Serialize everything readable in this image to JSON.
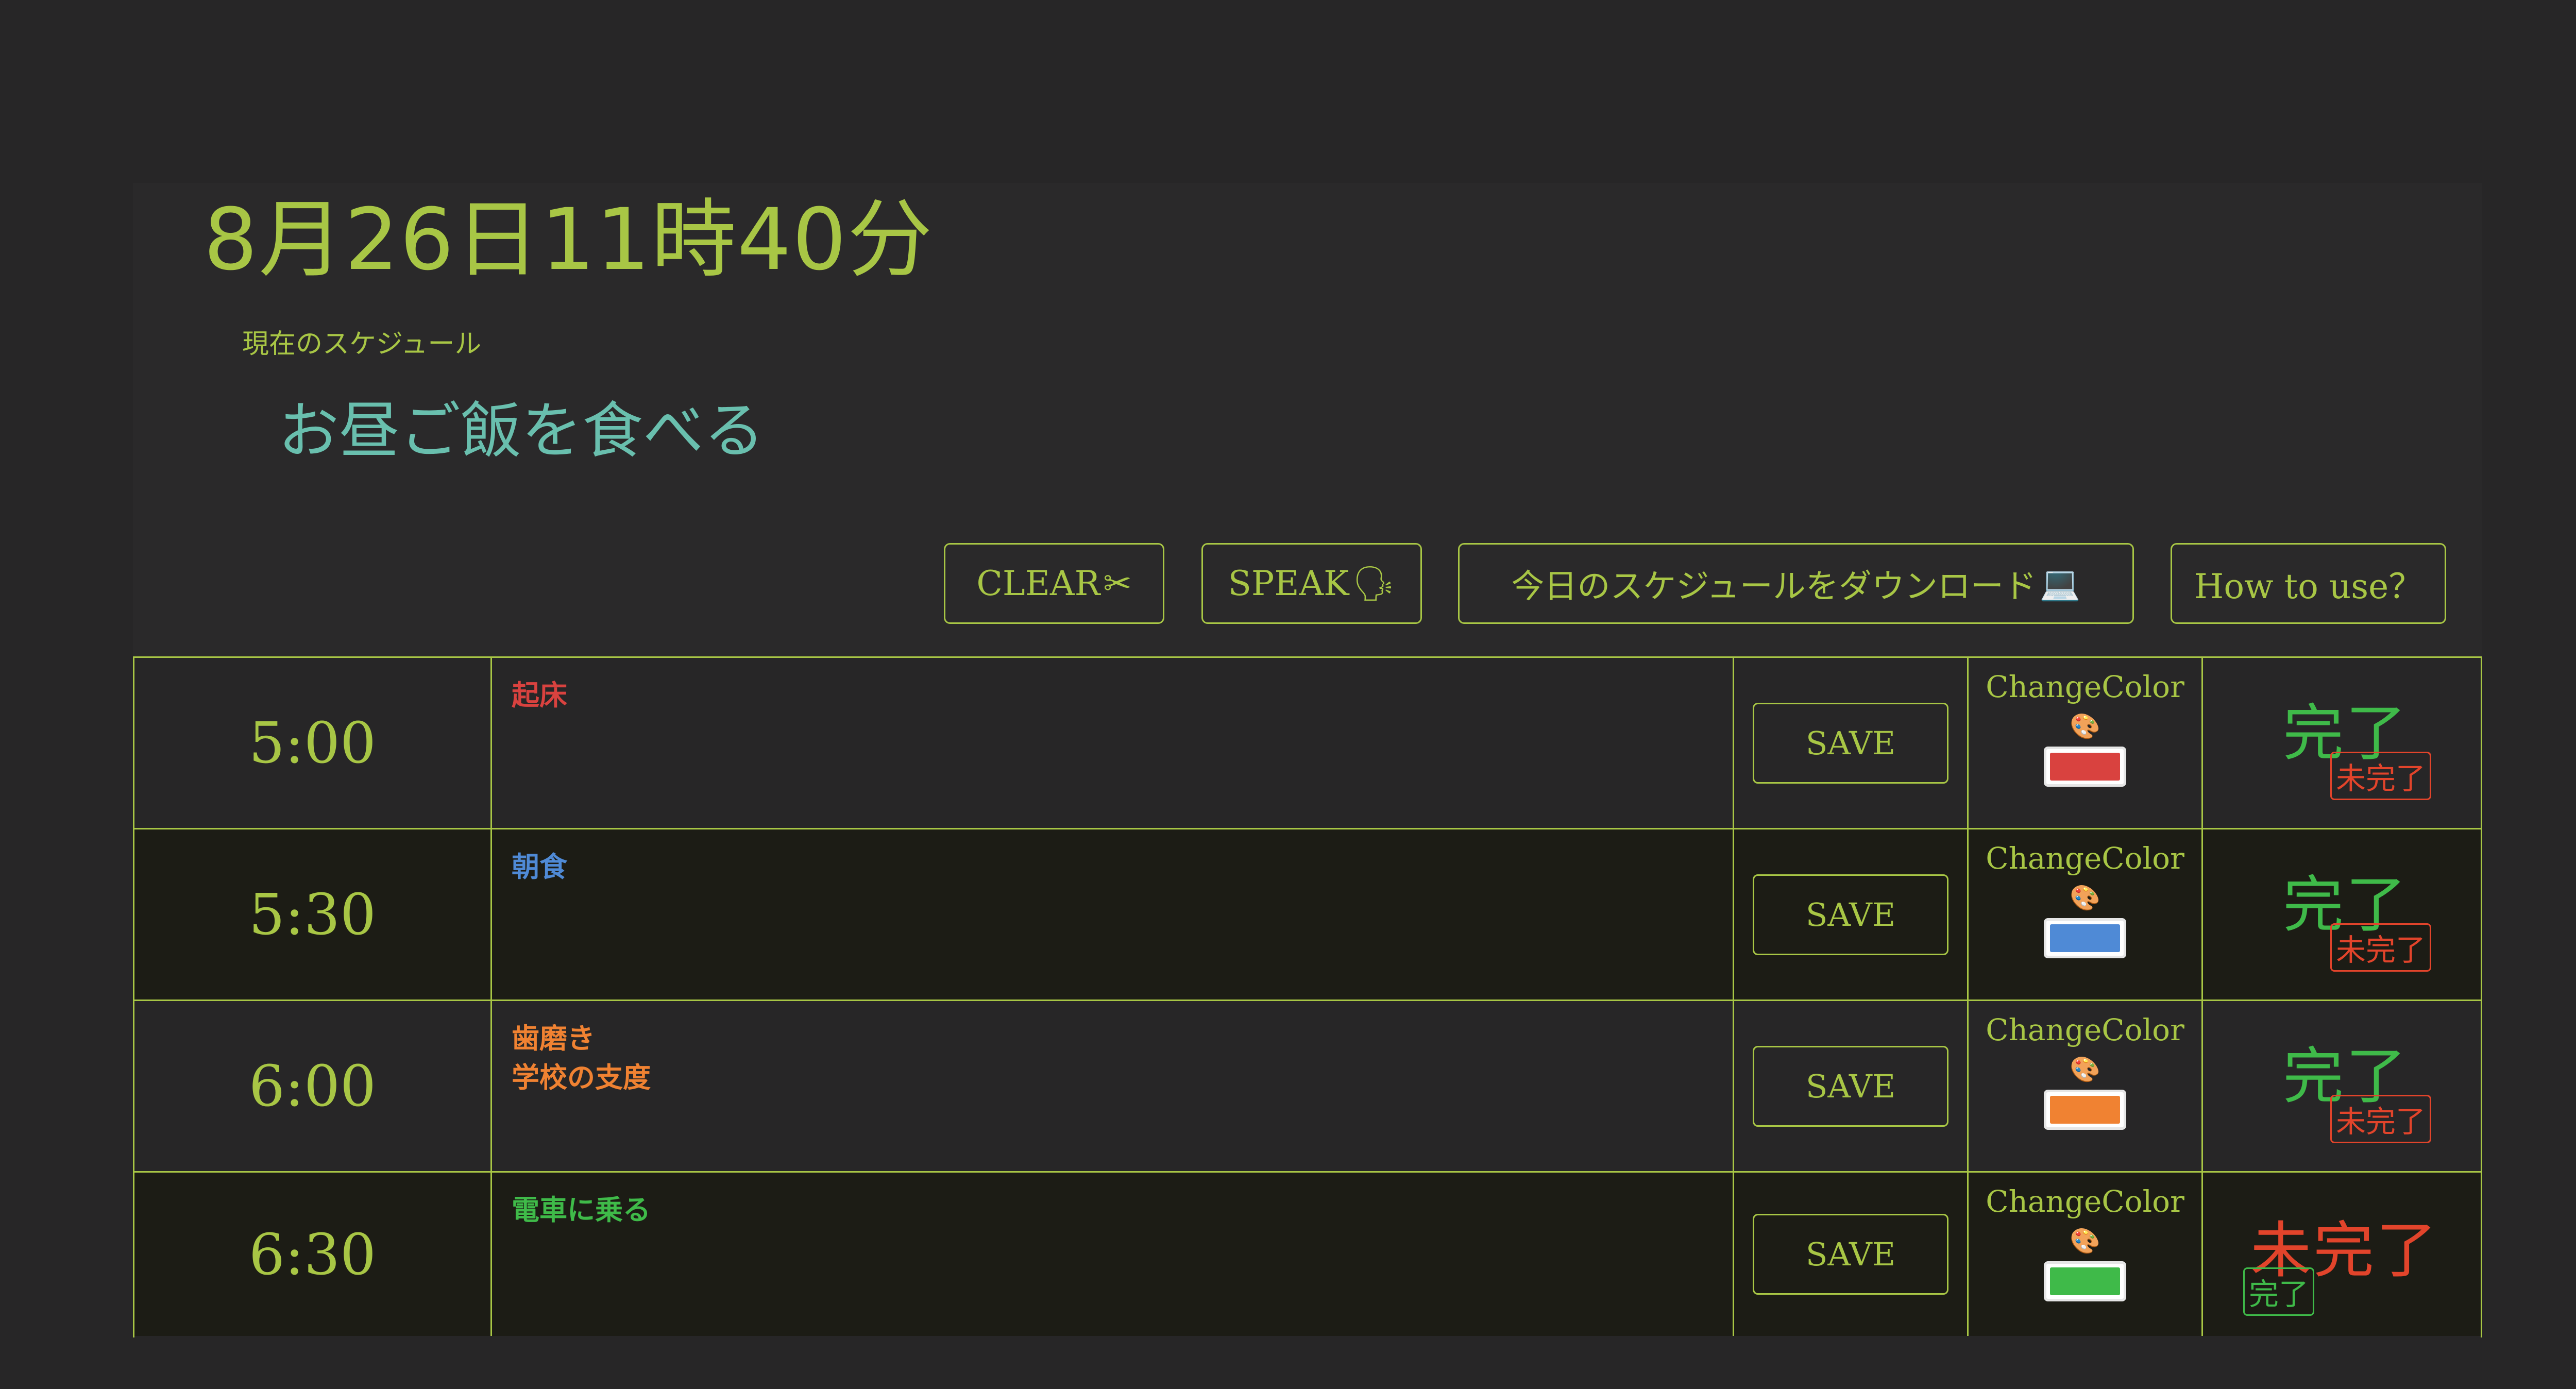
{
  "header": {
    "datetime": "8月26日11時40分",
    "current_label": "現在のスケジュール",
    "current_task": "お昼ご飯を食べる"
  },
  "toolbar": {
    "clear_label": "CLEAR",
    "clear_icon": "✂",
    "speak_label": "SPEAK",
    "speak_icon": "🗣",
    "download_label": "今日のスケジュールをダウンロード",
    "download_icon": "💻",
    "howto_label": "How to use？"
  },
  "colors": {
    "accent": "#a8c645",
    "done": "#3fba49",
    "undone": "#e2442b",
    "current_task": "#69bfae"
  },
  "schedule": [
    {
      "time": "5:00",
      "task_lines": [
        "起床",
        ""
      ],
      "task_color": "#d9423f",
      "save_label": "SAVE",
      "change_color_label": "ChangeColor",
      "palette_icon": "🎨",
      "swatch": "#d9423f",
      "status_primary": "完了",
      "status_secondary": "未完了",
      "state": "done"
    },
    {
      "time": "5:30",
      "task_lines": [
        "朝食",
        ""
      ],
      "task_color": "#4f8ad6",
      "save_label": "SAVE",
      "change_color_label": "ChangeColor",
      "palette_icon": "🎨",
      "swatch": "#4f8ad6",
      "status_primary": "完了",
      "status_secondary": "未完了",
      "state": "done"
    },
    {
      "time": "6:00",
      "task_lines": [
        "歯磨き",
        "学校の支度"
      ],
      "task_color": "#f08232",
      "save_label": "SAVE",
      "change_color_label": "ChangeColor",
      "palette_icon": "🎨",
      "swatch": "#f08232",
      "status_primary": "完了",
      "status_secondary": "未完了",
      "state": "done"
    },
    {
      "time": "6:30",
      "task_lines": [
        "電車に乗る",
        ""
      ],
      "task_color": "#3fba49",
      "save_label": "SAVE",
      "change_color_label": "ChangeColor",
      "palette_icon": "🎨",
      "swatch": "#3fba49",
      "status_primary": "未完了",
      "status_secondary": "完了",
      "state": "undone"
    }
  ]
}
